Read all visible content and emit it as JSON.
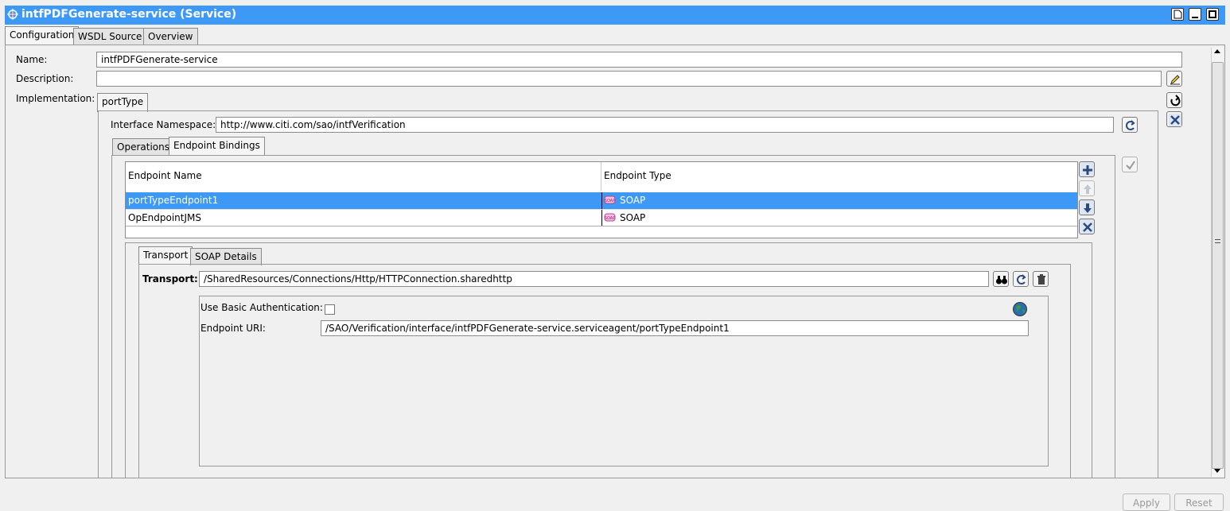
{
  "window": {
    "title": "intfPDFGenerate-service (Service)"
  },
  "main_tabs": [
    {
      "label": "Configuration"
    },
    {
      "label": "WSDL Source"
    },
    {
      "label": "Overview"
    }
  ],
  "form": {
    "name_label": "Name:",
    "name_value": "intfPDFGenerate-service",
    "description_label": "Description:",
    "description_value": "",
    "implementation_label": "Implementation:"
  },
  "impl_tabs": [
    {
      "label": "portType"
    }
  ],
  "interface": {
    "namespace_label": "Interface Namespace:",
    "namespace_value": "http://www.citi.com/sao/intfVerification"
  },
  "inner_tabs": [
    {
      "label": "Operations"
    },
    {
      "label": "Endpoint Bindings"
    }
  ],
  "endpoints": {
    "columns": [
      "Endpoint Name",
      "Endpoint Type"
    ],
    "rows": [
      {
        "name": "portTypeEndpoint1",
        "type": "SOAP",
        "type_icon": "soap-icon"
      },
      {
        "name": "OpEndpointJMS",
        "type": "SOAP",
        "type_icon": "soap-icon"
      }
    ]
  },
  "detail_tabs": [
    {
      "label": "Transport"
    },
    {
      "label": "SOAP Details"
    }
  ],
  "transport": {
    "label": "Transport:",
    "value": "/SharedResources/Connections/Http/HTTPConnection.sharedhttp",
    "basic_auth_label": "Use Basic Authentication:",
    "endpoint_uri_label": "Endpoint URI:",
    "endpoint_uri_value": "/SAO/Verification/interface/intfPDFGenerate-service.serviceagent/portTypeEndpoint1"
  },
  "footer": {
    "apply_label": "Apply",
    "reset_label": "Reset"
  },
  "colors": {
    "title_bar": "#3d99f5",
    "selection": "#3d99f5"
  }
}
